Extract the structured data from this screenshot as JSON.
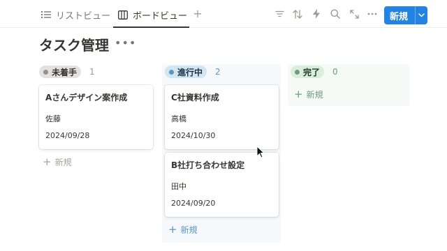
{
  "views": [
    {
      "label": "リストビュー",
      "icon": "list-icon",
      "active": false
    },
    {
      "label": "ボードビュー",
      "icon": "board-icon",
      "active": true
    }
  ],
  "toolbar": {
    "new_label": "新規",
    "tools": [
      "filter-icon",
      "sort-icon",
      "automation-bolt-icon",
      "search-icon",
      "expand-icon",
      "more-icon"
    ]
  },
  "page": {
    "title": "タスク管理",
    "more": "•••"
  },
  "colors": {
    "accent": "#2383e2",
    "todo_bg": "#e3e2e0",
    "todo_dot": "#91918e",
    "progress_bg": "#d3e5ef",
    "progress_dot": "#5b97bd",
    "done_bg": "#dbeddb",
    "done_dot": "#6c9b7d"
  },
  "columns": [
    {
      "status": "未着手",
      "count": "1",
      "add_label": "新規",
      "cards": [
        {
          "title": "Aさんデザイン案作成",
          "person": "佐藤",
          "date": "2024/09/28"
        }
      ]
    },
    {
      "status": "進行中",
      "count": "2",
      "add_label": "新規",
      "cards": [
        {
          "title": "C社資料作成",
          "person": "高橋",
          "date": "2024/10/30"
        },
        {
          "title": "B社打ち合わせ設定",
          "person": "田中",
          "date": "2024/09/20"
        }
      ]
    },
    {
      "status": "完了",
      "count": "0",
      "add_label": "新規",
      "cards": []
    }
  ]
}
